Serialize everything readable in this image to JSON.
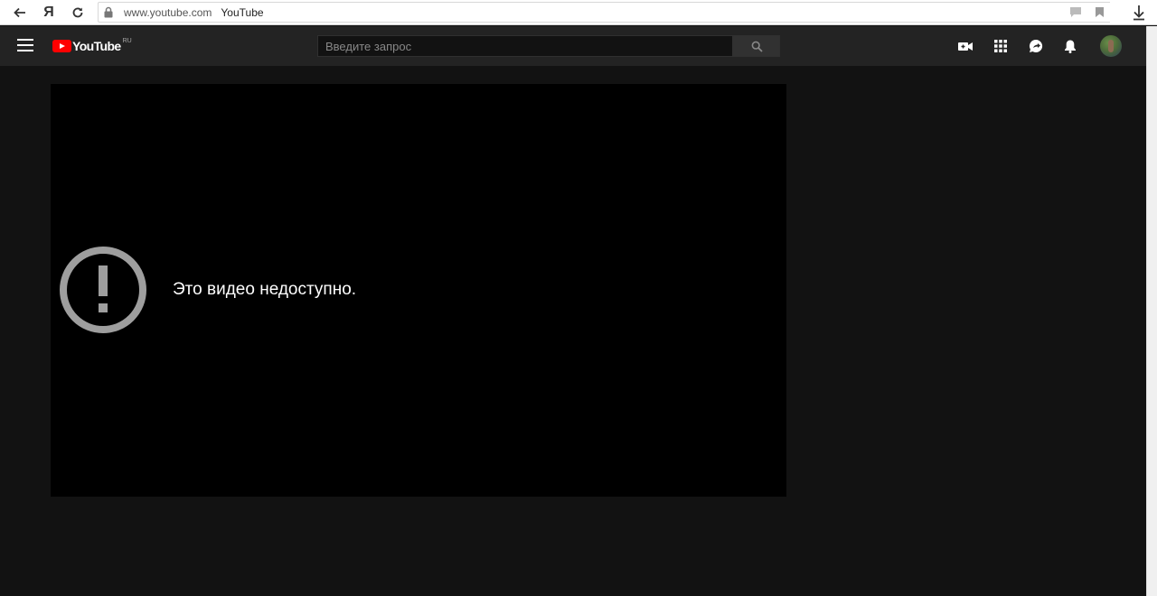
{
  "browser": {
    "url": "www.youtube.com",
    "page_title": "YouTube",
    "yandex_label": "Я"
  },
  "masthead": {
    "logo_text": "YouTube",
    "country_code": "RU",
    "search_placeholder": "Введите запрос"
  },
  "player": {
    "error_message": "Это видео недоступно."
  },
  "colors": {
    "brand_red": "#ff0000",
    "masthead_bg": "#232323",
    "page_bg": "#121212",
    "player_bg": "#000000",
    "error_icon": "#9e9e9e"
  }
}
